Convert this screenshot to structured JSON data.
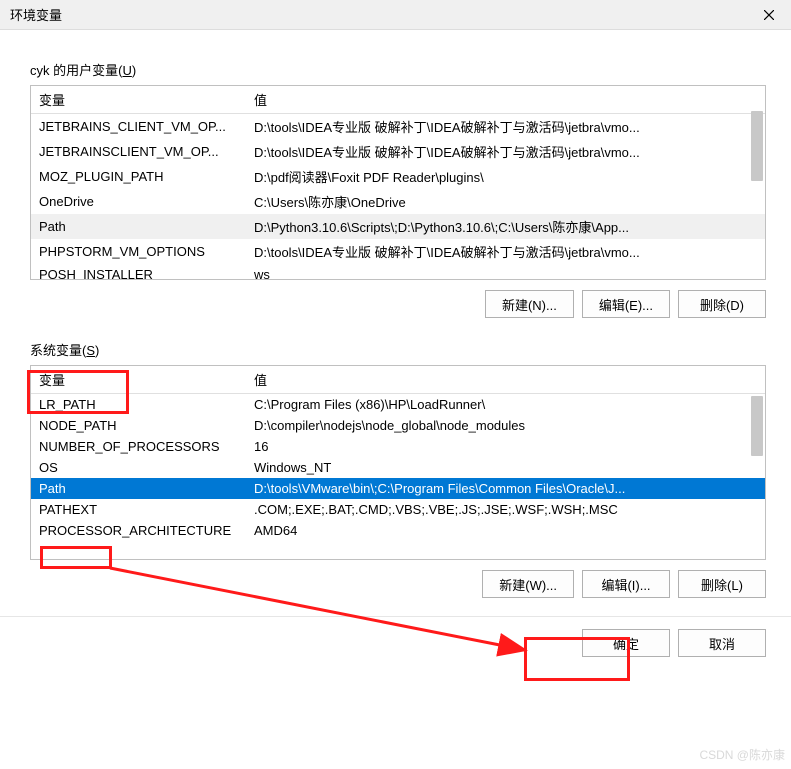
{
  "title_bar": {
    "title": "环境变量"
  },
  "user_section": {
    "label_prefix": "cyk 的用户变量(",
    "label_key": "U",
    "label_suffix": ")"
  },
  "headers": {
    "variable": "变量",
    "value": "值"
  },
  "user_vars": [
    {
      "name": "JETBRAINS_CLIENT_VM_OP...",
      "value": "D:\\tools\\IDEA专业版 破解补丁\\IDEA破解补丁与激活码\\jetbra\\vmo..."
    },
    {
      "name": "JETBRAINSCLIENT_VM_OP...",
      "value": "D:\\tools\\IDEA专业版 破解补丁\\IDEA破解补丁与激活码\\jetbra\\vmo..."
    },
    {
      "name": "MOZ_PLUGIN_PATH",
      "value": "D:\\pdf阅读器\\Foxit PDF Reader\\plugins\\"
    },
    {
      "name": "OneDrive",
      "value": "C:\\Users\\陈亦康\\OneDrive"
    },
    {
      "name": "Path",
      "value": "D:\\Python3.10.6\\Scripts\\;D:\\Python3.10.6\\;C:\\Users\\陈亦康\\App...",
      "highlighted": true
    },
    {
      "name": "PHPSTORM_VM_OPTIONS",
      "value": "D:\\tools\\IDEA专业版 破解补丁\\IDEA破解补丁与激活码\\jetbra\\vmo..."
    },
    {
      "name": "POSH_INSTALLER",
      "value": "ws"
    }
  ],
  "system_section": {
    "label_prefix": "系统变量(",
    "label_key": "S",
    "label_suffix": ")"
  },
  "system_vars": [
    {
      "name": "LR_PATH",
      "value": "C:\\Program Files (x86)\\HP\\LoadRunner\\"
    },
    {
      "name": "NODE_PATH",
      "value": "D:\\compiler\\nodejs\\node_global\\node_modules"
    },
    {
      "name": "NUMBER_OF_PROCESSORS",
      "value": "16"
    },
    {
      "name": "OS",
      "value": "Windows_NT"
    },
    {
      "name": "Path",
      "value": "D:\\tools\\VMware\\bin\\;C:\\Program Files\\Common Files\\Oracle\\J...",
      "selected": true
    },
    {
      "name": "PATHEXT",
      "value": ".COM;.EXE;.BAT;.CMD;.VBS;.VBE;.JS;.JSE;.WSF;.WSH;.MSC"
    },
    {
      "name": "PROCESSOR_ARCHITECTURE",
      "value": "AMD64"
    }
  ],
  "buttons": {
    "new_n": "新建(N)...",
    "edit_e": "编辑(E)...",
    "delete_d": "删除(D)",
    "new_w": "新建(W)...",
    "edit_i": "编辑(I)...",
    "delete_l": "删除(L)",
    "ok": "确定",
    "cancel": "取消"
  },
  "watermark": "CSDN @陈亦康"
}
